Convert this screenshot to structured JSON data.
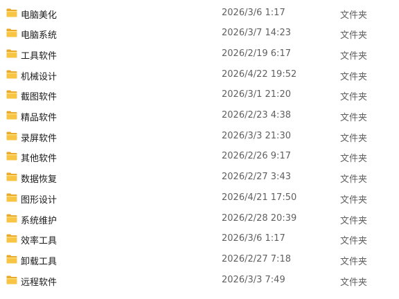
{
  "icons": {
    "folder": "folder-icon"
  },
  "colors": {
    "folder_body": "#F8C443",
    "folder_back": "#E9A92A",
    "folder_light": "#FFE28A"
  },
  "rows": [
    {
      "name": "电脑美化",
      "modified": "2026/3/6 1:17",
      "type": "文件夹"
    },
    {
      "name": "电脑系统",
      "modified": "2026/3/7 14:23",
      "type": "文件夹"
    },
    {
      "name": "工具软件",
      "modified": "2026/2/19 6:17",
      "type": "文件夹"
    },
    {
      "name": "机械设计",
      "modified": "2026/4/22 19:52",
      "type": "文件夹"
    },
    {
      "name": "截图软件",
      "modified": "2026/3/1 21:20",
      "type": "文件夹"
    },
    {
      "name": "精品软件",
      "modified": "2026/2/23 4:38",
      "type": "文件夹"
    },
    {
      "name": "录屏软件",
      "modified": "2026/3/3 21:30",
      "type": "文件夹"
    },
    {
      "name": "其他软件",
      "modified": "2026/2/26 9:17",
      "type": "文件夹"
    },
    {
      "name": "数据恢复",
      "modified": "2026/2/27 3:43",
      "type": "文件夹"
    },
    {
      "name": "图形设计",
      "modified": "2026/4/21 17:50",
      "type": "文件夹"
    },
    {
      "name": "系统维护",
      "modified": "2026/2/28 20:39",
      "type": "文件夹"
    },
    {
      "name": "效率工具",
      "modified": "2026/3/6 1:17",
      "type": "文件夹"
    },
    {
      "name": "卸载工具",
      "modified": "2026/2/27 7:18",
      "type": "文件夹"
    },
    {
      "name": "远程软件",
      "modified": "2026/3/3 7:49",
      "type": "文件夹"
    }
  ]
}
